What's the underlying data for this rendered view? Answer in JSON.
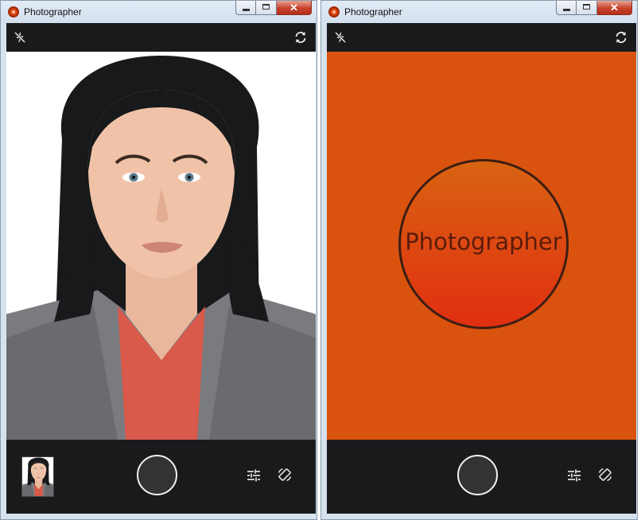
{
  "windows": [
    {
      "title": "Photographer",
      "icons": {
        "flash": "flash-off-icon",
        "switch_camera": "switch-camera-icon",
        "settings": "settings-sliders-icon",
        "rotate": "screen-rotation-icon"
      },
      "viewport": "camera-preview-portrait"
    },
    {
      "title": "Photographer",
      "icons": {
        "flash": "flash-off-icon",
        "switch_camera": "switch-camera-icon",
        "settings": "settings-sliders-icon",
        "rotate": "screen-rotation-icon"
      },
      "splash_text": "Photographer",
      "splash_color": "#d9530f"
    }
  ],
  "colors": {
    "bar_background": "#1a1a1c",
    "shutter_fill": "#333335",
    "shutter_ring": "#f2f2f2",
    "splash_background": "#d9530f",
    "logo_gradient_top": "#d86312",
    "logo_gradient_bottom": "#e12f10"
  }
}
